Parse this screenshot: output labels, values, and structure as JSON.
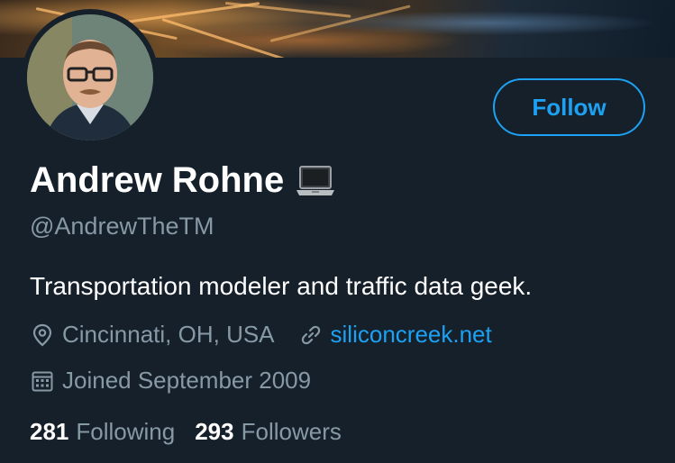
{
  "profile": {
    "display_name": "Andrew Rohne",
    "name_emoji": "laptop-icon",
    "handle": "@AndrewTheTM",
    "bio": "Transportation modeler and traffic data geek.",
    "location": "Cincinnati, OH, USA",
    "website": "siliconcreek.net",
    "joined": "Joined September 2009"
  },
  "actions": {
    "follow_label": "Follow"
  },
  "stats": {
    "following_count": "281",
    "following_label": "Following",
    "followers_count": "293",
    "followers_label": "Followers"
  },
  "colors": {
    "background": "#15202b",
    "accent": "#1da1f2",
    "secondary_text": "#8899a6",
    "primary_text": "#ffffff"
  },
  "icons": {
    "location": "map-pin-icon",
    "website": "link-icon",
    "joined": "calendar-icon"
  }
}
